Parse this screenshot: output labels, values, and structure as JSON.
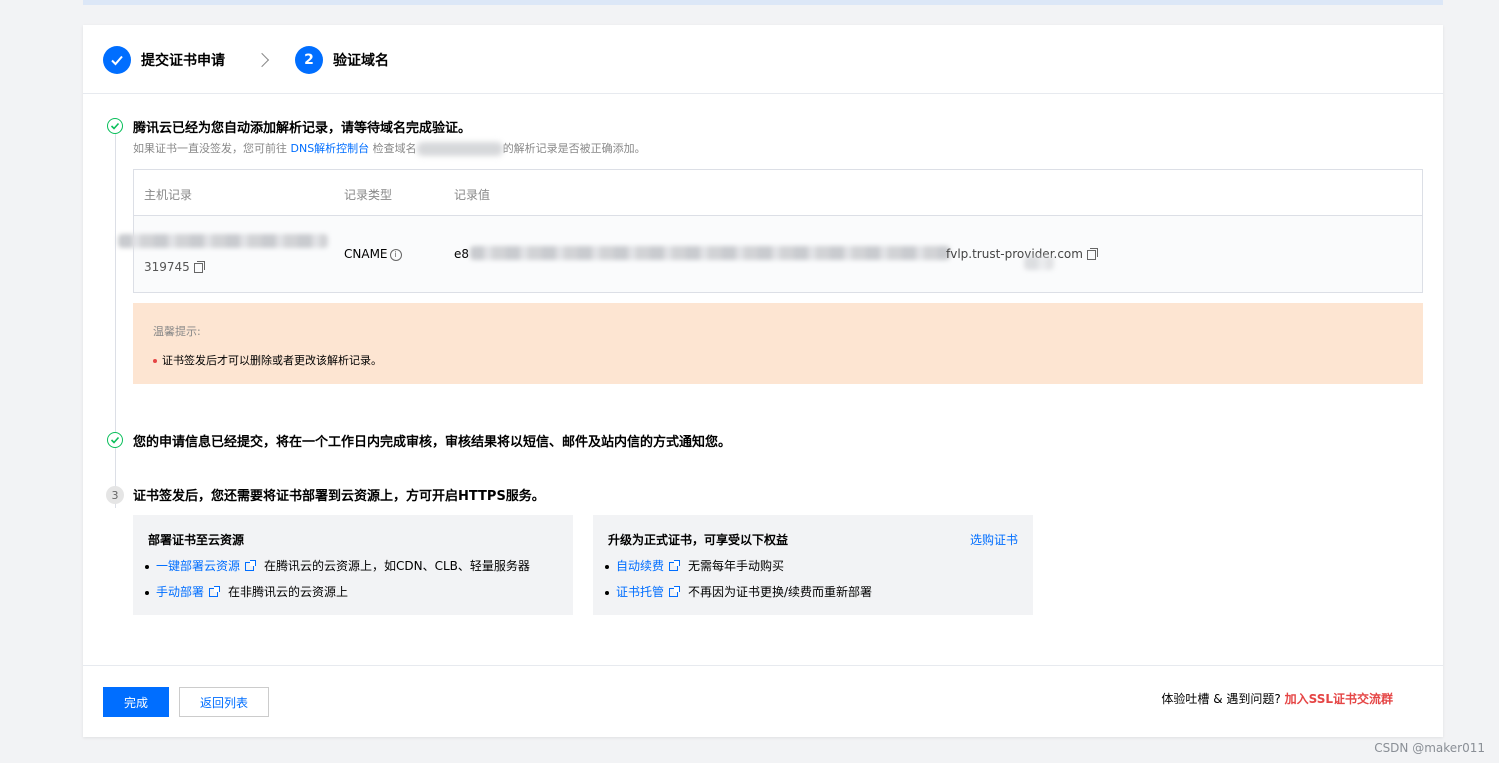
{
  "steps": [
    {
      "label": "提交证书申请",
      "status": "done"
    },
    {
      "number": "2",
      "label": "验证域名",
      "status": "active"
    }
  ],
  "section1": {
    "title": "腾讯云已经为您自动添加解析记录，请等待域名完成验证。",
    "sub_prefix": "如果证书一直没签发，您可前往 ",
    "sub_link": "DNS解析控制台",
    "sub_middle": " 检查域名",
    "sub_suffix": "的解析记录是否被正确添加。"
  },
  "dns_table": {
    "headers": [
      "主机记录",
      "记录类型",
      "记录值"
    ],
    "row": {
      "host_tail": "319745",
      "type": "CNAME",
      "value_prefix": "e8",
      "value_suffix": "fvlp.trust-provider.com"
    }
  },
  "notice": {
    "title": "温馨提示:",
    "item": "证书签发后才可以删除或者更改该解析记录。"
  },
  "section2": {
    "title": "您的申请信息已经提交，将在一个工作日内完成审核，审核结果将以短信、邮件及站内信的方式通知您。"
  },
  "section3": {
    "number": "3",
    "title": "证书签发后，您还需要将证书部署到云资源上，方可开启HTTPS服务。"
  },
  "deploy_box": {
    "title": "部署证书至云资源",
    "items": [
      {
        "link": "一键部署云资源",
        "desc": "在腾讯云的云资源上，如CDN、CLB、轻量服务器"
      },
      {
        "link": "手动部署",
        "desc": "在非腾讯云的云资源上"
      }
    ]
  },
  "upgrade_box": {
    "title": "升级为正式证书，可享受以下权益",
    "action": "选购证书",
    "items": [
      {
        "link": "自动续费",
        "desc": "无需每年手动购买"
      },
      {
        "link": "证书托管",
        "desc": "不再因为证书更换/续费而重新部署"
      }
    ]
  },
  "footer": {
    "done_label": "完成",
    "back_label": "返回列表",
    "feedback_text": "体验吐槽 & 遇到问题?",
    "feedback_link": "加入SSL证书交流群"
  },
  "watermark": "CSDN @maker011",
  "colors": {
    "primary": "#006eff",
    "success": "#0abf5b",
    "warning_bg": "#fde5d2",
    "danger": "#e54545"
  }
}
